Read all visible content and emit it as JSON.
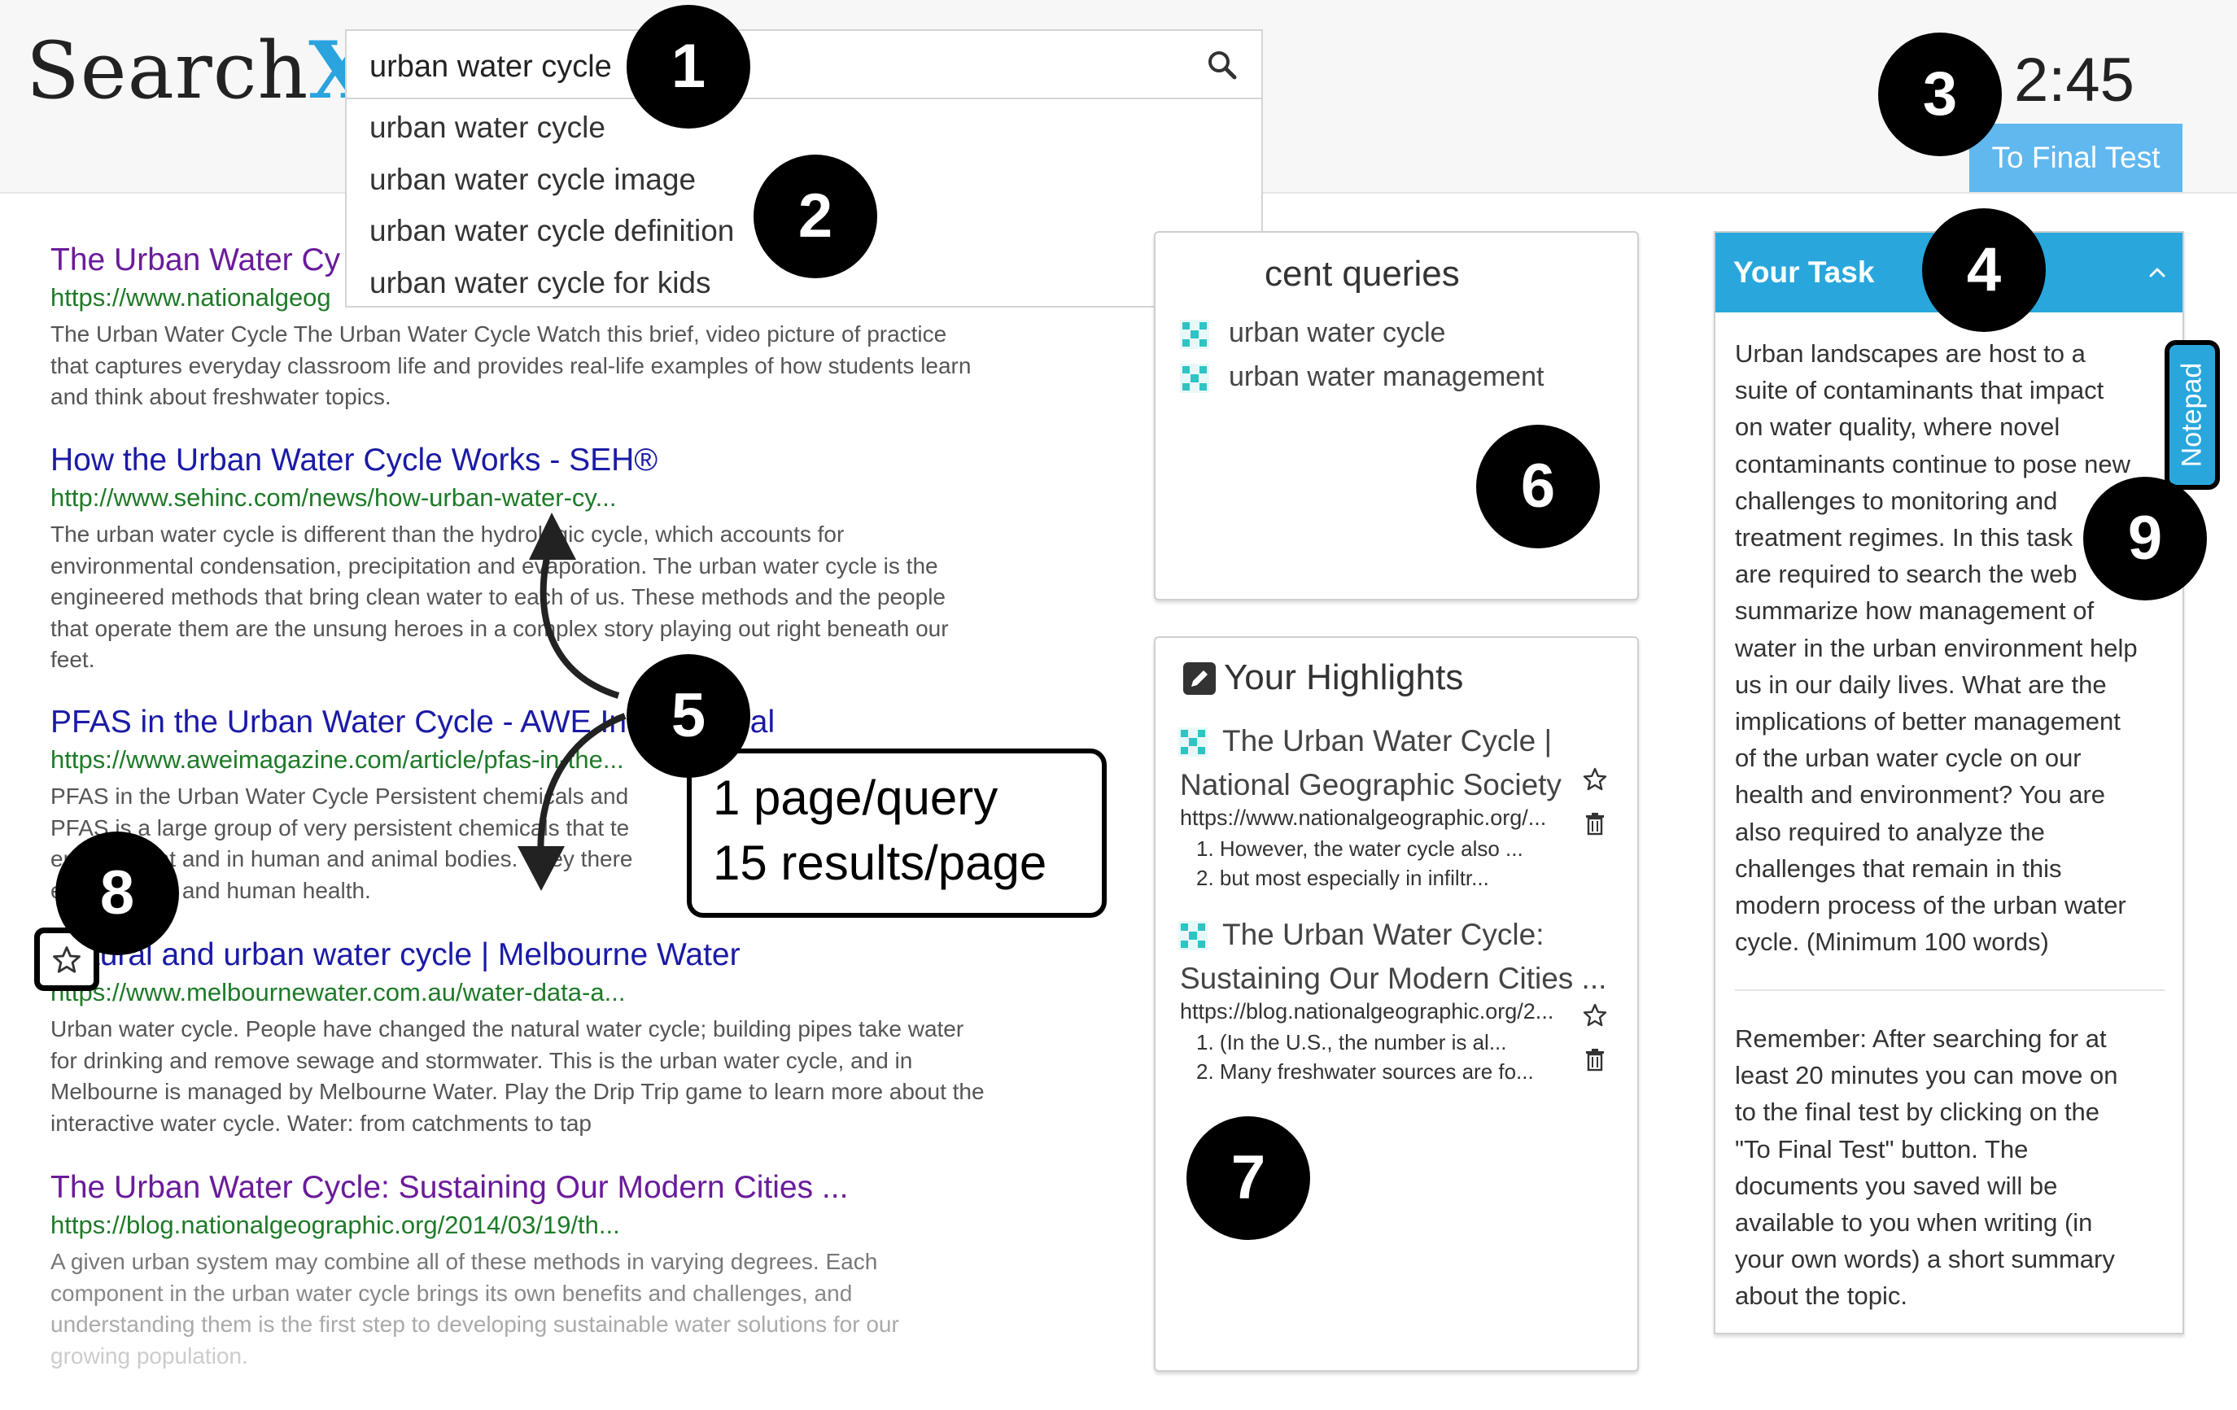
{
  "header": {
    "logo_text": "Search",
    "logo_x": "X",
    "search_value": "urban water cycle",
    "suggestions": [
      "urban water cycle",
      "urban water cycle image",
      "urban water cycle definition",
      "urban water cycle for kids"
    ],
    "timer": "2:45",
    "final_test_label": "To Final Test"
  },
  "results": [
    {
      "title": "The Urban Water Cy",
      "url": "https://www.nationalgeog",
      "snippet_lines": [
        "The Urban Water Cycle The Urban Water Cycle Watch this brief, video picture of practice",
        "that captures everyday classroom life and provides real-life examples of how students learn",
        "and think about freshwater topics."
      ]
    },
    {
      "title": "How the Urban Water Cycle Works - SEH®",
      "url": "http://www.sehinc.com/news/how-urban-water-cy...",
      "snippet_lines": [
        "The urban water cycle is different than the hydrologic cycle, which accounts for",
        "environmental condensation, precipitation and evaporation. The urban water cycle is the",
        "engineered methods that bring clean water to each of us. These methods and the people",
        "that operate them are the unsung heroes in a complex story playing out right beneath our",
        "feet."
      ]
    },
    {
      "title": "PFAS in the Urban Water Cycle - AWE International",
      "url": "https://www.aweimagazine.com/article/pfas-in-the...",
      "snippet_lines": [
        "PFAS in the Urban Water Cycle Persistent chemicals and",
        "PFAS is a large group of very persistent chemicals that te",
        "environment and in human and animal bodies. They there",
        "environment and human health."
      ]
    },
    {
      "title": "Natural and urban water cycle | Melbourne Water",
      "url": "https://www.melbournewater.com.au/water-data-a...",
      "snippet_lines": [
        "Urban water cycle. People have changed the natural water cycle; building pipes take water",
        "for drinking and remove sewage and stormwater. This is the urban water cycle, and in",
        "Melbourne is managed by Melbourne Water. Play the Drip Trip game to learn more about the",
        "interactive water cycle. Water: from catchments to tap"
      ]
    },
    {
      "title": "The Urban Water Cycle: Sustaining Our Modern Cities ...",
      "url": "https://blog.nationalgeographic.org/2014/03/19/th...",
      "snippet_lines": [
        "A given urban system may combine all of these methods in varying degrees. Each",
        "component in the urban water cycle brings its own benefits and challenges, and",
        "understanding them is the first step to developing sustainable water solutions for our",
        "growing population."
      ]
    }
  ],
  "recent_queries": {
    "title": "cent queries",
    "items": [
      "urban water cycle",
      "urban water management"
    ]
  },
  "highlights": {
    "title": "Your Highlights",
    "items": [
      {
        "title_lines": [
          "The Urban Water Cycle |",
          "National Geographic Society"
        ],
        "url": "https://www.nationalgeographic.org/...",
        "snippets": [
          "1. However, the water cycle also ...",
          "2. but most especially in infiltr..."
        ]
      },
      {
        "title_lines": [
          "The Urban Water Cycle:",
          "Sustaining Our Modern Cities ..."
        ],
        "url": "https://blog.nationalgeographic.org/2...",
        "snippets": [
          "1. (In the U.S., the number is al...",
          "2. Many freshwater sources are fo..."
        ]
      }
    ]
  },
  "task": {
    "title": "Your Task",
    "description_lines": [
      "Urban landscapes are host to a",
      "suite of contaminants that impact",
      "on water quality, where novel",
      "contaminants continue to pose new",
      "challenges to monitoring and",
      "treatment regimes. In this task",
      "are required to search the web",
      "summarize how management of",
      "water in the urban environment help",
      "us in our daily lives. What are the",
      "implications of better management",
      "of the urban water cycle on our",
      "health and environment? You are",
      "also required to analyze the",
      "challenges that remain in this",
      "modern process of the urban water",
      "cycle. (Minimum 100 words)"
    ],
    "reminder_lines": [
      "Remember: After searching for at",
      "least 20 minutes you can move on",
      "to the final test by clicking on the",
      "\"To Final Test\" button. The",
      "documents you saved will be",
      "available to you when writing (in",
      "your own words) a short summary",
      "about the topic."
    ]
  },
  "notepad_label": "Notepad",
  "annotations": {
    "badges": [
      "1",
      "2",
      "3",
      "4",
      "5",
      "6",
      "7",
      "8",
      "9"
    ],
    "callout_lines": [
      "1 page/query",
      "15 results/page"
    ]
  },
  "colors": {
    "accent": "#29a7dc",
    "button": "#61b8ef",
    "visited_link": "#6a1b9a",
    "link": "#1a1aa6",
    "url_green": "#1e7a28"
  },
  "icons": [
    "search-icon",
    "star-icon",
    "trash-icon",
    "pencil-icon",
    "chevron-up-icon",
    "favicon-icon"
  ]
}
